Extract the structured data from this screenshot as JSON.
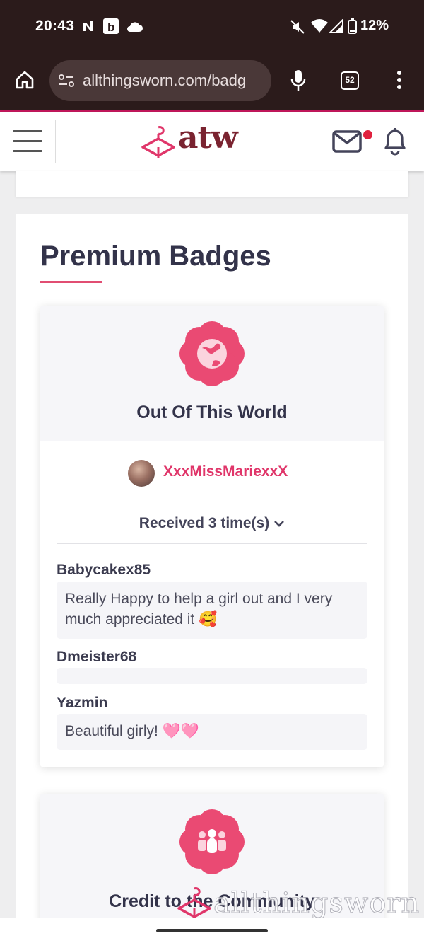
{
  "status_bar": {
    "time": "20:43",
    "battery": "12%",
    "icons": [
      "notification-n-icon",
      "notification-b-icon",
      "cloud-icon",
      "mute-icon",
      "wifi-icon",
      "signal-icon",
      "battery-icon"
    ]
  },
  "browser": {
    "url": "allthingsworn.com/badg",
    "tab_count": "52"
  },
  "header": {
    "logo_text": "atw",
    "accent": "#e0366a",
    "brand_color": "#7a2330"
  },
  "section": {
    "title": "Premium Badges"
  },
  "badge": {
    "name": "Out Of This World",
    "owner": "XxxMissMariexxX",
    "received_label": "Received 3 time(s)",
    "entries": [
      {
        "name": "Babycakex85",
        "message": "Really Happy to help a girl out and I very much appreciated it 🥰"
      },
      {
        "name": "Dmeister68",
        "message": ""
      },
      {
        "name": "Yazmin",
        "message": "Beautiful girly! 🩷🩷"
      }
    ]
  },
  "badge2": {
    "name": "Credit to the Community"
  },
  "watermark": {
    "text": "allthingsworn"
  }
}
